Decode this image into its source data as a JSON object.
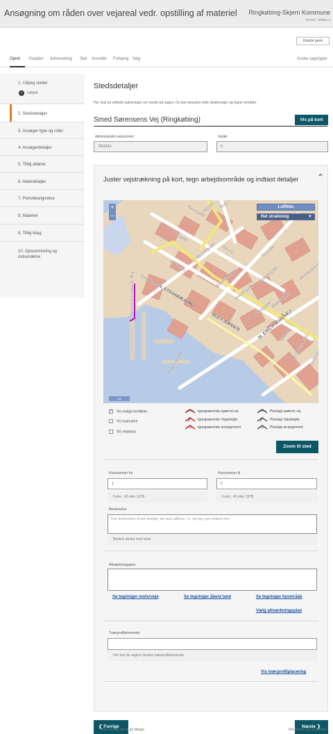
{
  "header": {
    "title": "Ansøgning om råden over vejareal vedr. opstilling af materiel",
    "municipality": "Ringkøbing-Skjern Kommune",
    "version": "ROVer: 100861.4"
  },
  "draft_save": "Kladde gemt",
  "topnav": {
    "items": [
      "Opret",
      "Kladder",
      "Adressebog",
      "Slet",
      "Annullér",
      "Forlæng",
      "Søg"
    ],
    "other": "Andre sagstyper"
  },
  "sidebar": {
    "steps": [
      "1. Udpeg steder",
      "2. Stedsdetaljer",
      "3. Ansøger type og roller",
      "4. Ansøgerdetaljer",
      "5. Tilføj aktører",
      "6. Aktørdetaljer",
      "7. Periodeangivelse",
      "8. Materiel",
      "9. Tilføj bilag",
      "10. Opsummering og indsendelse"
    ],
    "step1_badge": "Udfyldt"
  },
  "main": {
    "section_title": "Stedsdetaljer",
    "intro": "Her skal du udfylde oplysninger om steder på sagen. Du kan desuden rette strækninger og tegne områder.",
    "road_name": "Smed Sørensens Vej (Ringkøbing)",
    "show_on_map": "Vis på kort",
    "admin_road_no_label": "Administrativt vejnummer",
    "admin_road_no": "7601814",
    "road_part_label": "Vejdel",
    "road_part": "0"
  },
  "panel": {
    "title": "Juster vejstrækning på kort, tegn arbejdsområde og indtast detaljer",
    "map_tab_aerial": "Luftfoto",
    "map_tab_edit": "Ret strækning",
    "zoom_in": "+",
    "zoom_out": "–",
    "scale": "100",
    "map_labels": [
      "Torvegade",
      "Holmene",
      "Beddingen",
      "Torvet",
      "Nygade",
      "V. STRANDBJERG",
      "V. Strandgade",
      "Grønnegade",
      "Smedegade",
      "Østerdade",
      "Mellemgade",
      "Ø. Strandgade",
      "VED FJORDEN",
      "M. ERICHSENS VEJ",
      "Fiskerstræde",
      "Tofteen",
      "Smed Sørensens Vej",
      "Rebslagervej",
      "Bag Torvet",
      "Algade",
      "Torvegade",
      "Jordgaardsvej",
      "Fjord Alle"
    ],
    "checkboxes": [
      {
        "label": "Vis mulige konflikter",
        "checked": "✓"
      },
      {
        "label": "Vis husnumre",
        "checked": ""
      },
      {
        "label": "Vis vejstatus",
        "checked": ""
      }
    ],
    "legend": [
      "Igangværende spærret vej",
      "Igangværende Vejarbejde",
      "Igangværende arrangement",
      "Planlagt spærret vej",
      "Planlagt Vejarbejde",
      "Planlagt arrangement"
    ],
    "zoom_to_place": "Zoom til sted",
    "house_from_label": "Husnummer fra",
    "house_from": "1",
    "house_to_label": "Husnummer til",
    "house_to": "5",
    "house_hint": "F.eks.: 42 eller 137B",
    "desc_label": "Beskrivelse",
    "desc_placeholder": "Kort beskrivelse af det arbejde, der skal udføres. f.x. nyt tag, nye vinduer mm",
    "desc_hint": "Beskriv stedet med tekst",
    "marking_label": "Afmærkningsplan",
    "link_motorway": "Se tegninger motorveje",
    "link_open": "Se tegninger åbent land",
    "link_city": "Se tegninger byområde",
    "link_choose_plan": "Vælg afmærkningsplan",
    "profile_label": "Tværprofilelementer",
    "profile_hint": "Her kan du angive berørte tværprofilelementer",
    "link_profile": "Vis tværprofilplacering"
  },
  "footer": {
    "prev": "Forrige",
    "next": "Næste",
    "prev_hint": "Klik Forrige for at gå tilbage",
    "next_hint": "Klik Næste for at gemme"
  },
  "colors": {
    "primary": "#0c5765",
    "active_step": "#e07b1a",
    "link": "#174f9c"
  }
}
